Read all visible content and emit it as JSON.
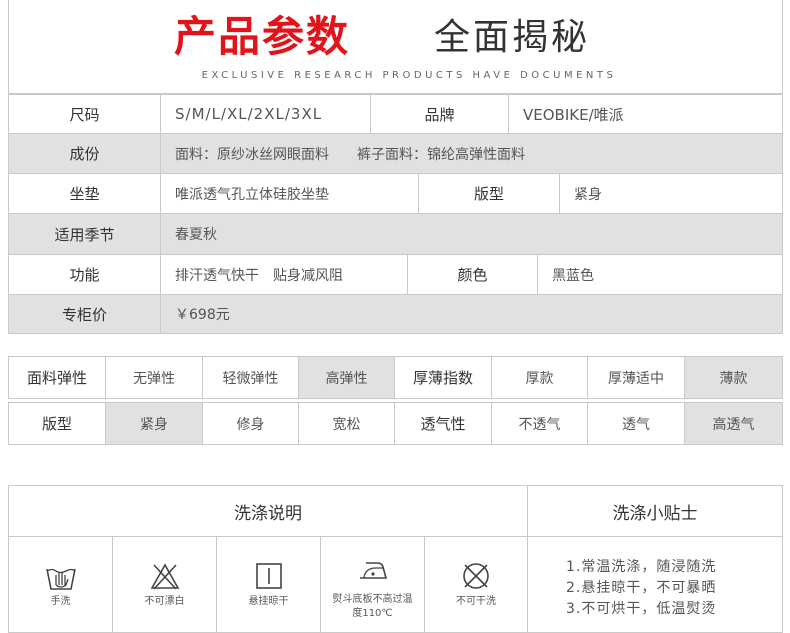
{
  "header": {
    "title_red": "产品参数",
    "title_thin": "全面揭秘",
    "subtitle": "EXCLUSIVE RESEARCH PRODUCTS HAVE DOCUMENTS"
  },
  "params": {
    "size_label": "尺码",
    "size_value": "S/M/L/XL/2XL/3XL",
    "brand_label": "品牌",
    "brand_value": "VEOBIKE/唯派",
    "material_label": "成份",
    "material_value": "面料：原纱冰丝网眼面料　　裤子面料：锦纶高弹性面料",
    "pad_label": "坐垫",
    "pad_value": "唯派透气孔立体硅胶坐垫",
    "fit_label": "版型",
    "fit_value": "紧身",
    "season_label": "适用季节",
    "season_value": "春夏秋",
    "function_label": "功能",
    "function_value": "排汗透气快干　贴身减风阻",
    "color_label": "颜色",
    "color_value": "黑蓝色",
    "price_label": "专柜价",
    "price_value": "￥698元"
  },
  "attributes": {
    "row1": [
      "面料弹性",
      "无弹性",
      "轻微弹性",
      "高弹性",
      "厚薄指数",
      "厚款",
      "厚薄适中",
      "薄款"
    ],
    "row2": [
      "版型",
      "紧身",
      "修身",
      "宽松",
      "透气性",
      "不透气",
      "透气",
      "高透气"
    ]
  },
  "care": {
    "title": "洗涤说明",
    "tips_title": "洗涤小贴士",
    "icons": [
      {
        "icon": "hand-wash-icon",
        "label": "手洗"
      },
      {
        "icon": "no-bleach-icon",
        "label": "不可漂白"
      },
      {
        "icon": "hang-dry-icon",
        "label": "悬挂晾干"
      },
      {
        "icon": "iron-low-icon",
        "label": "熨斗底板不高过温度110℃"
      },
      {
        "icon": "no-dry-clean-icon",
        "label": "不可干洗"
      }
    ],
    "tips": [
      "1.常温洗涤，随浸随洗",
      "2.悬挂晾干，不可暴晒",
      "3.不可烘干，低温熨烫"
    ]
  },
  "colors": {
    "accent_red": "#e2141b",
    "gray_cell": "#e1e1e1",
    "border": "#c9c9c9"
  }
}
